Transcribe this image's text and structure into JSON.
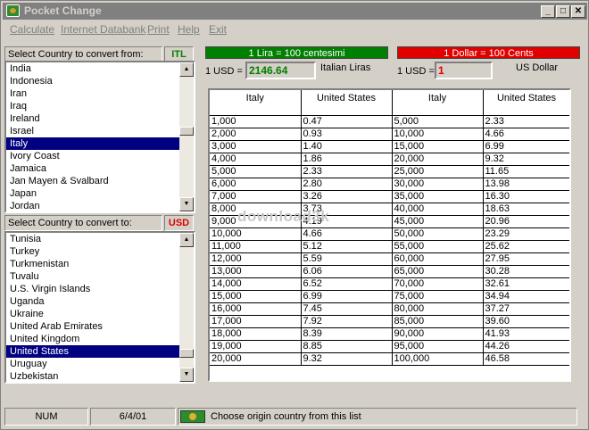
{
  "app": {
    "title": "Pocket Change"
  },
  "menu": [
    "Calculate",
    "Internet Databank",
    "Print",
    "Help",
    "Exit"
  ],
  "titlebar": {
    "minimize": "_",
    "maximize": "□",
    "close": "✕"
  },
  "from": {
    "label": "Select Country to convert from:",
    "code": "ITL",
    "items": [
      "India",
      "Indonesia",
      "Iran",
      "Iraq",
      "Ireland",
      "Israel",
      "Italy",
      "Ivory Coast",
      "Jamaica",
      "Jan Mayen & Svalbard",
      "Japan",
      "Jordan"
    ],
    "selected_index": 6
  },
  "to": {
    "label": "Select Country to convert to:",
    "code": "USD",
    "items": [
      "Tunisia",
      "Turkey",
      "Turkmenistan",
      "Tuvalu",
      "U.S. Virgin Islands",
      "Uganda",
      "Ukraine",
      "United Arab Emirates",
      "United Kingdom",
      "United States",
      "Uruguay",
      "Uzbekistan"
    ],
    "selected_index": 9
  },
  "rates": {
    "from_unit": "1 Lira = 100 centesimi",
    "to_unit": "1 Dollar = 100 Cents",
    "usd_label": "1 USD =",
    "from_rate": "2146.64",
    "from_name": "Italian Liras",
    "to_rate": "1",
    "to_name": "US Dollar"
  },
  "table": {
    "headers": [
      "Italy",
      "United States",
      "Italy",
      "United States"
    ],
    "rows": [
      [
        "1,000",
        "0.47",
        "5,000",
        "2.33"
      ],
      [
        "2,000",
        "0.93",
        "10,000",
        "4.66"
      ],
      [
        "3,000",
        "1.40",
        "15,000",
        "6.99"
      ],
      [
        "4,000",
        "1.86",
        "20,000",
        "9.32"
      ],
      [
        "5,000",
        "2.33",
        "25,000",
        "11.65"
      ],
      [
        "6,000",
        "2.80",
        "30,000",
        "13.98"
      ],
      [
        "7,000",
        "3.26",
        "35,000",
        "16.30"
      ],
      [
        "8,000",
        "3.73",
        "40,000",
        "18.63"
      ],
      [
        "9,000",
        "4.19",
        "45,000",
        "20.96"
      ],
      [
        "10,000",
        "4.66",
        "50,000",
        "23.29"
      ],
      [
        "11,000",
        "5.12",
        "55,000",
        "25.62"
      ],
      [
        "12,000",
        "5.59",
        "60,000",
        "27.95"
      ],
      [
        "13,000",
        "6.06",
        "65,000",
        "30.28"
      ],
      [
        "14,000",
        "6.52",
        "70,000",
        "32.61"
      ],
      [
        "15,000",
        "6.99",
        "75,000",
        "34.94"
      ],
      [
        "16,000",
        "7.45",
        "80,000",
        "37.27"
      ],
      [
        "17,000",
        "7.92",
        "85,000",
        "39.60"
      ],
      [
        "18,000",
        "8.39",
        "90,000",
        "41.93"
      ],
      [
        "19,000",
        "8.85",
        "95,000",
        "44.26"
      ],
      [
        "20,000",
        "9.32",
        "100,000",
        "46.58"
      ]
    ]
  },
  "status": {
    "num": "NUM",
    "date": "6/4/01",
    "message": "Choose origin country from this list"
  },
  "watermark": "download3k",
  "colors": {
    "from_bar": "#008000",
    "to_bar": "#e00000",
    "from_code": "#008000",
    "to_code": "#e00000",
    "selection": "#000080"
  }
}
